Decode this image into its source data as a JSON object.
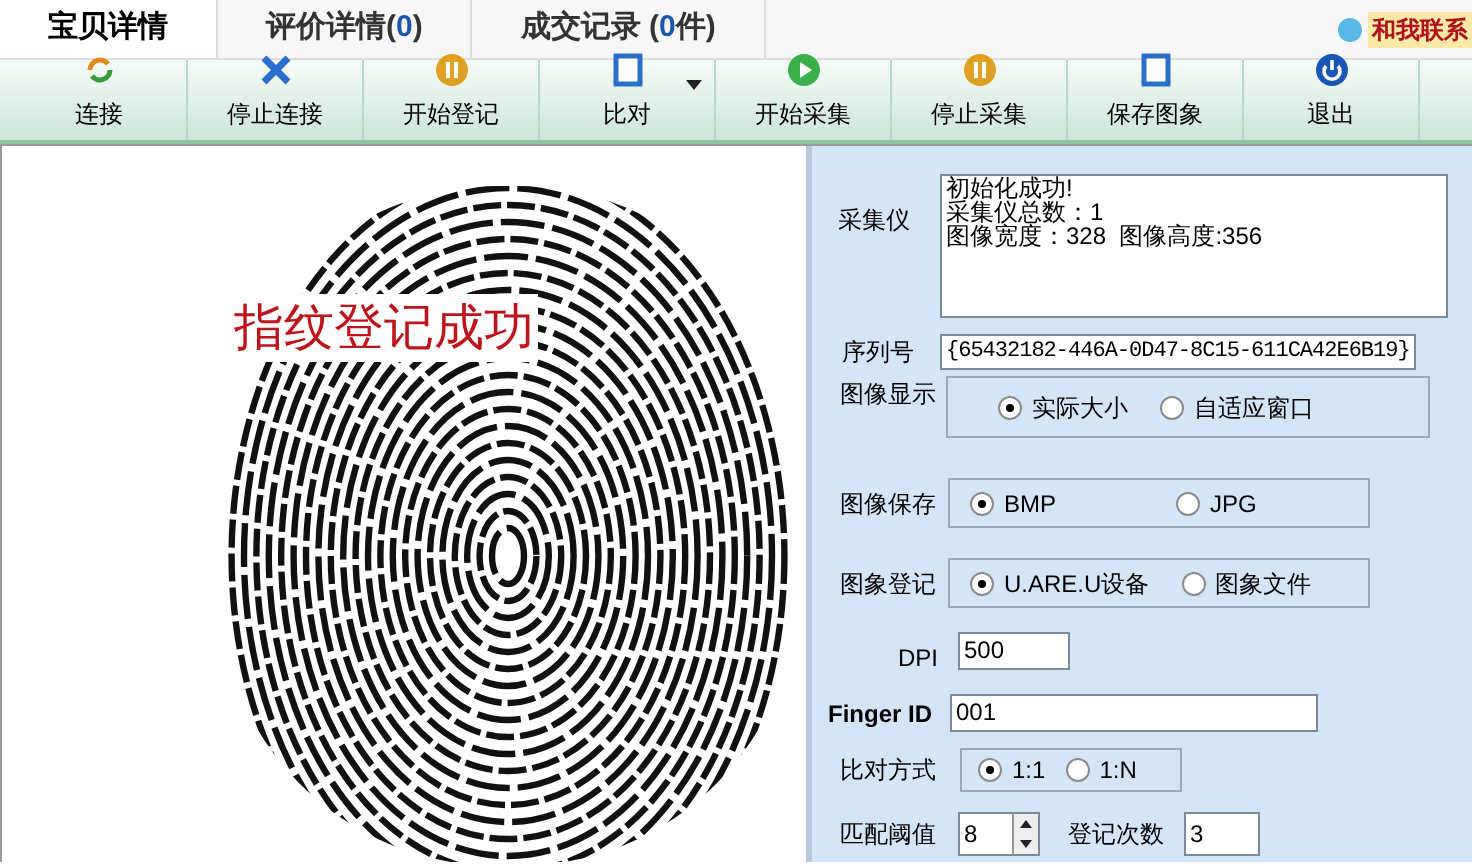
{
  "tabs": [
    {
      "label": "宝贝详情",
      "selected": true
    },
    {
      "label": "评价详情(",
      "count": "0",
      "suffix": ")",
      "selected": false
    },
    {
      "label": "成交记录 (",
      "count": "0",
      "suffix": "件)",
      "selected": false
    }
  ],
  "contact_link": "和我联系",
  "toolbar": [
    {
      "label": "连接",
      "has_menu": false
    },
    {
      "label": "停止连接",
      "has_menu": false
    },
    {
      "label": "开始登记",
      "has_menu": false
    },
    {
      "label": "比对",
      "has_menu": true
    },
    {
      "label": "开始采集",
      "has_menu": false
    },
    {
      "label": "停止采集",
      "has_menu": false
    },
    {
      "label": "保存图象",
      "has_menu": false
    },
    {
      "label": "退出",
      "has_menu": false
    }
  ],
  "image_panel": {
    "overlay_message": "指纹登记成功"
  },
  "settings": {
    "device": {
      "label": "采集仪",
      "log": [
        "初始化成功!",
        "采集仪总数：1",
        "图像宽度：328  图像高度:356"
      ]
    },
    "serial": {
      "label": "序列号",
      "value": "{65432182-446A-0D47-8C15-611CA42E6B19}"
    },
    "display": {
      "label": "图像显示",
      "options": [
        {
          "label": "实际大小",
          "selected": true
        },
        {
          "label": "自适应窗口",
          "selected": false
        }
      ]
    },
    "save_format": {
      "label": "图像保存",
      "options": [
        {
          "label": "BMP",
          "selected": true
        },
        {
          "label": "JPG",
          "selected": false
        }
      ]
    },
    "enroll_source": {
      "label": "图象登记",
      "options": [
        {
          "label": "U.ARE.U设备",
          "selected": true
        },
        {
          "label": "图象文件",
          "selected": false
        }
      ]
    },
    "dpi": {
      "label": "DPI",
      "value": "500"
    },
    "finger_id": {
      "label": "Finger ID",
      "value": "001"
    },
    "match_mode": {
      "label": "比对方式",
      "options": [
        {
          "label": "1:1",
          "selected": true
        },
        {
          "label": "1:N",
          "selected": false
        }
      ]
    },
    "threshold": {
      "label": "匹配阈值",
      "value": "8"
    },
    "enroll_count": {
      "label": "登记次数",
      "value": "3"
    }
  }
}
